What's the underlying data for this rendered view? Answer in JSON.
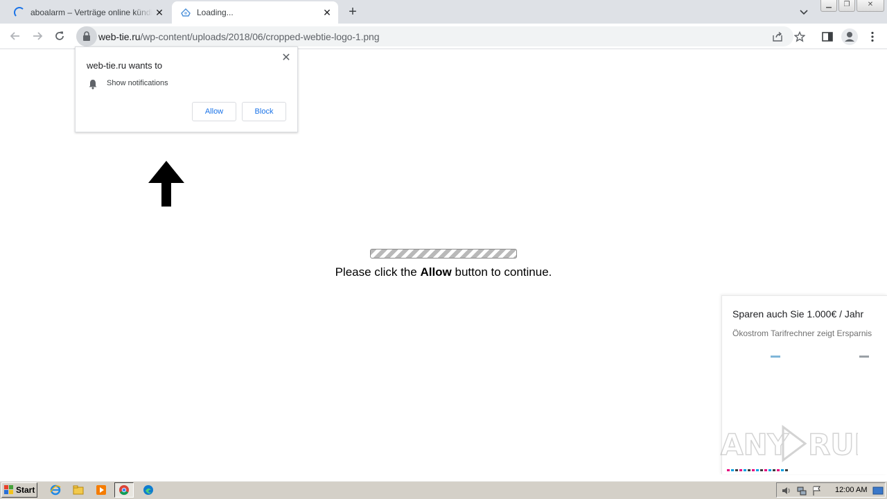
{
  "tabs": [
    {
      "title": "aboalarm – Verträge online kündigen",
      "state": "loading"
    },
    {
      "title": "Loading...",
      "state": "active"
    }
  ],
  "omnibox": {
    "host": "web-tie.ru",
    "path": "/wp-content/uploads/2018/06/cropped-webtie-logo-1.png"
  },
  "permission_prompt": {
    "title": "web-tie.ru wants to",
    "permission": "Show notifications",
    "allow_label": "Allow",
    "block_label": "Block"
  },
  "page": {
    "progress_text_before": "Please click the ",
    "progress_text_bold": "Allow",
    "progress_text_after": " button to continue."
  },
  "ad": {
    "title": "Sparen auch Sie 1.000€ / Jahr",
    "subtitle": "Ökostrom Tarifrechner zeigt Ersparnis"
  },
  "watermark": "ANY RUN",
  "taskbar": {
    "start_label": "Start",
    "clock": "12:00 AM",
    "apps": [
      "ie-icon",
      "explorer-icon",
      "media-player-icon",
      "chrome-icon",
      "edge-icon"
    ]
  },
  "colors": {
    "accent": "#1a73e8",
    "tabstrip": "#dee1e6",
    "taskbar": "#d4d0c8"
  }
}
